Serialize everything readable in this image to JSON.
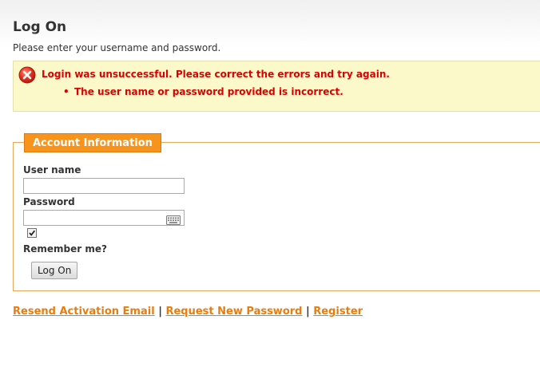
{
  "page": {
    "title": "Log On",
    "subtitle": "Please enter your username and password."
  },
  "error": {
    "summary": "Login was unsuccessful. Please correct the errors and try again.",
    "items": [
      "The user name or password provided is incorrect."
    ]
  },
  "form": {
    "legend": "Account Information",
    "username_label": "User name",
    "username_value": "",
    "password_label": "Password",
    "password_value": "",
    "remember_checked": true,
    "remember_label": "Remember me?",
    "submit_label": "Log On"
  },
  "links": {
    "resend": "Resend Activation Email",
    "separator": "|",
    "request_password": "Request New Password",
    "register": "Register"
  },
  "colors": {
    "accent": "#f7941e",
    "link": "#e87d0e",
    "error_text": "#dd0000",
    "error_bg": "#fbf8c9"
  },
  "icons": {
    "error": "error-x-circle-icon",
    "keyboard": "keyboard-icon",
    "check": "checkmark-icon"
  }
}
